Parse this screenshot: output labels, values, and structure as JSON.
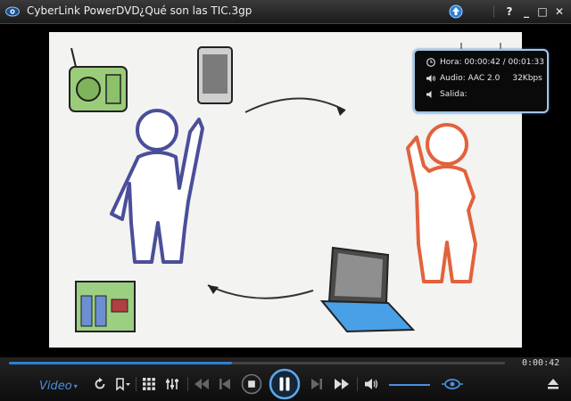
{
  "window": {
    "app_title": "CyberLink PowerDVD",
    "file_title": "¿Qué son las TIC.3gp",
    "buttons": [
      "?",
      "_",
      "□",
      "✕"
    ]
  },
  "osd": {
    "time_label": "Hora: 00:00:42 / 00:01:33",
    "audio_label": "Audio: AAC 2.0",
    "audio_bitrate": "32Kbps",
    "output_label": "Salida:"
  },
  "controls": {
    "video_menu": "Video",
    "elapsed": "0:00:42",
    "progress": 0.45
  },
  "colors": {
    "accent": "#2f7fd0",
    "osd_border": "#9fc8ea"
  }
}
